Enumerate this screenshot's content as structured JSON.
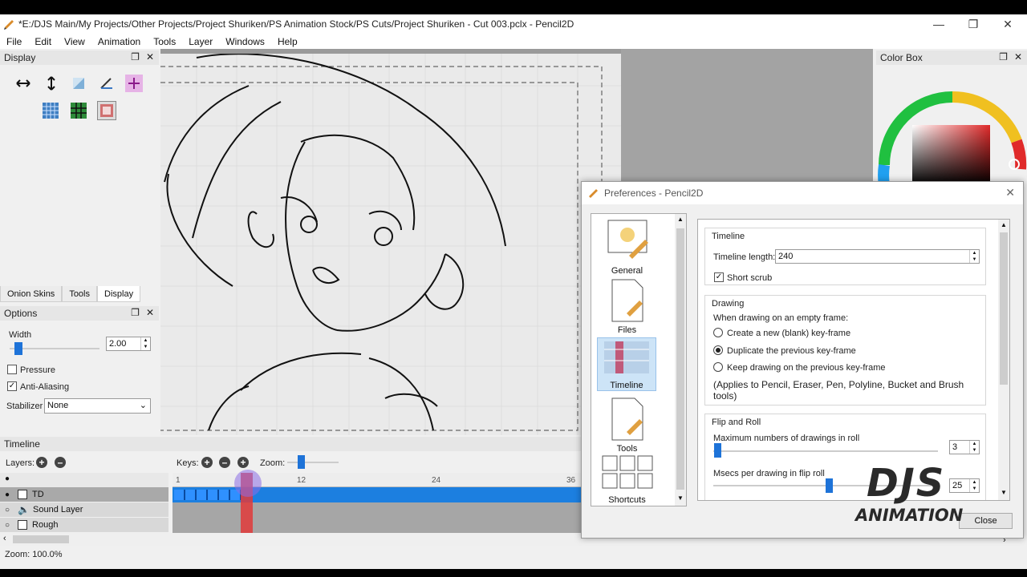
{
  "window": {
    "title": "*E:/DJS Main/My Projects/Other Projects/Project Shuriken/PS Animation Stock/PS Cuts/Project Shuriken - Cut 003.pclx - Pencil2D"
  },
  "menu": [
    "File",
    "Edit",
    "View",
    "Animation",
    "Tools",
    "Layer",
    "Windows",
    "Help"
  ],
  "display_panel": {
    "title": "Display"
  },
  "left_tabs": [
    "Onion Skins",
    "Tools",
    "Display"
  ],
  "options": {
    "title": "Options",
    "width_label": "Width",
    "width_value": "2.00",
    "pressure": "Pressure",
    "anti_aliasing": "Anti-Aliasing",
    "stabilizer_label": "Stabilizer",
    "stabilizer_value": "None"
  },
  "color_box": {
    "title": "Color Box"
  },
  "timeline": {
    "title": "Timeline",
    "layers_label": "Layers:",
    "keys_label": "Keys:",
    "zoom_label": "Zoom:",
    "ticks": [
      "1",
      "12",
      "24",
      "36"
    ],
    "layers": [
      {
        "name": "TD"
      },
      {
        "name": "Sound Layer"
      },
      {
        "name": "Rough"
      }
    ]
  },
  "status": {
    "zoom": "Zoom: 100.0%"
  },
  "preferences": {
    "title": "Preferences - Pencil2D",
    "categories": [
      "General",
      "Files",
      "Timeline",
      "Tools",
      "Shortcuts"
    ],
    "timeline_group": "Timeline",
    "timeline_length_label": "Timeline length:",
    "timeline_length": "240",
    "short_scrub": "Short scrub",
    "drawing_group": "Drawing",
    "empty_frame_label": "When drawing on an empty frame:",
    "options": [
      "Create a new (blank) key-frame",
      "Duplicate the previous key-frame",
      "Keep drawing on the previous key-frame"
    ],
    "selected_option": 1,
    "applies_note": "(Applies to Pencil, Eraser, Pen, Polyline, Bucket and Brush tools)",
    "flip_group": "Flip and Roll",
    "max_drawings_label": "Maximum numbers of drawings in roll",
    "max_drawings": "3",
    "msecs_label": "Msecs per drawing in flip roll",
    "msecs": "25",
    "close": "Close"
  },
  "watermark": {
    "line1": "DJS",
    "line2": "ANIMATION"
  },
  "colors": {
    "accent": "#1e73d8",
    "playhead": "#e03a3a",
    "track": "#1c7fe0"
  }
}
